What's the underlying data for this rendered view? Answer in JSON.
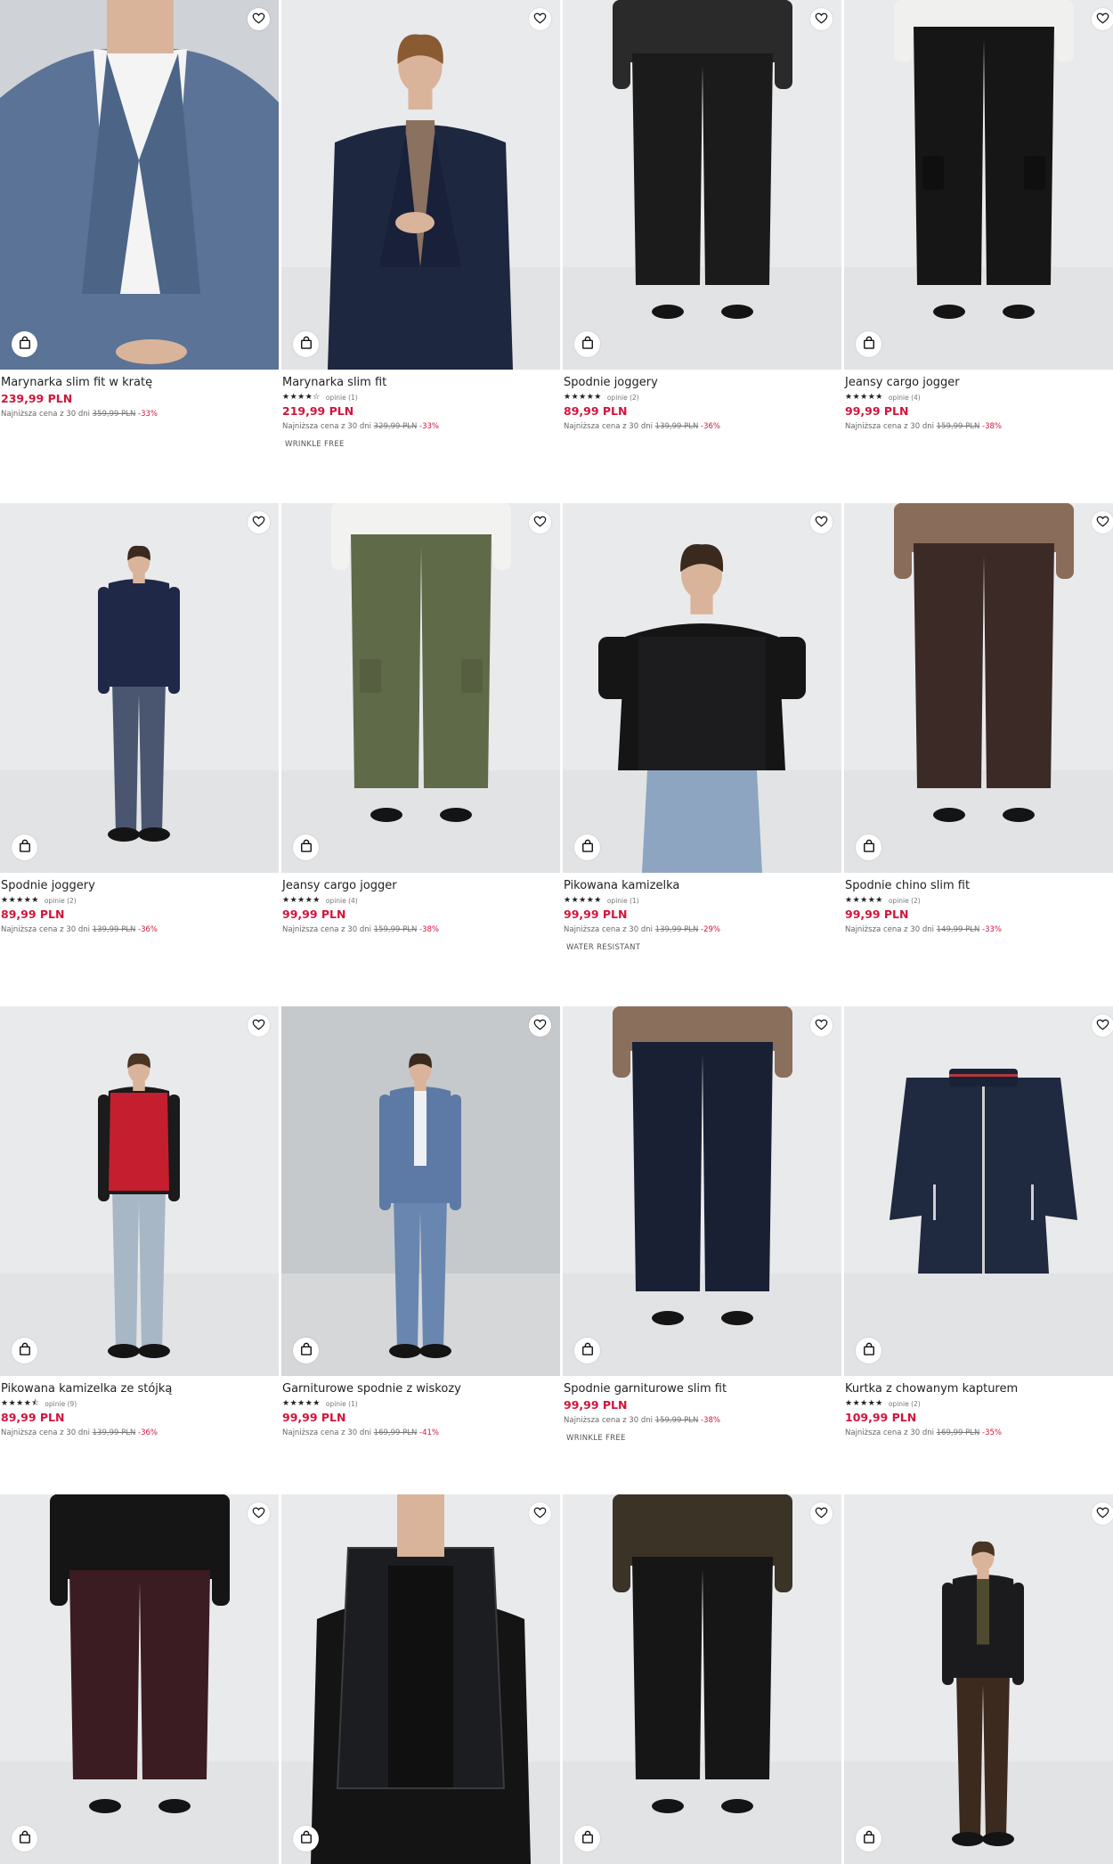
{
  "labels": {
    "lowest_prefix": "Najniższa cena z 30 dni"
  },
  "colors": {
    "price": "#d4143c",
    "text": "#222222",
    "background": "#ffffff"
  },
  "icons": {
    "favorite": "heart-icon",
    "cart": "shopping-bag-icon"
  },
  "products": [
    {
      "name": "Marynarka slim fit w kratę",
      "rating": null,
      "reviews": null,
      "price": "239,99 PLN",
      "old_price": "359,99 PLN",
      "discount": "-33%",
      "tag": null,
      "scene": "blazer-check"
    },
    {
      "name": "Marynarka slim fit",
      "rating": 4,
      "reviews": "opinie (1)",
      "price": "219,99 PLN",
      "old_price": "329,99 PLN",
      "discount": "-33%",
      "tag": "WRINKLE FREE",
      "scene": "blazer-navy"
    },
    {
      "name": "Spodnie joggery",
      "rating": 5,
      "reviews": "opinie (2)",
      "price": "89,99 PLN",
      "old_price": "139,99 PLN",
      "discount": "-36%",
      "tag": null,
      "scene": "pants-black"
    },
    {
      "name": "Jeansy cargo jogger",
      "rating": 5,
      "reviews": "opinie (4)",
      "price": "99,99 PLN",
      "old_price": "159,99 PLN",
      "discount": "-38%",
      "tag": null,
      "scene": "cargo-black"
    },
    {
      "name": "Spodnie joggery",
      "rating": 5,
      "reviews": "opinie (2)",
      "price": "89,99 PLN",
      "old_price": "139,99 PLN",
      "discount": "-36%",
      "tag": null,
      "scene": "full-navy"
    },
    {
      "name": "Jeansy cargo jogger",
      "rating": 5,
      "reviews": "opinie (4)",
      "price": "99,99 PLN",
      "old_price": "159,99 PLN",
      "discount": "-38%",
      "tag": null,
      "scene": "cargo-olive"
    },
    {
      "name": "Pikowana kamizelka",
      "rating": 5,
      "reviews": "opinie (1)",
      "price": "99,99 PLN",
      "old_price": "139,99 PLN",
      "discount": "-29%",
      "tag": "WATER RESISTANT",
      "scene": "vest-black"
    },
    {
      "name": "Spodnie chino slim fit",
      "rating": 5,
      "reviews": "opinie (2)",
      "price": "99,99 PLN",
      "old_price": "149,99 PLN",
      "discount": "-33%",
      "tag": null,
      "scene": "chino-brown"
    },
    {
      "name": "Pikowana kamizelka ze stójką",
      "rating": 4.5,
      "reviews": "opinie (9)",
      "price": "89,99 PLN",
      "old_price": "139,99 PLN",
      "discount": "-36%",
      "tag": null,
      "scene": "vest-red"
    },
    {
      "name": "Garniturowe spodnie z wiskozy",
      "rating": 5,
      "reviews": "opinie (1)",
      "price": "99,99 PLN",
      "old_price": "169,99 PLN",
      "discount": "-41%",
      "tag": null,
      "scene": "suit-blue"
    },
    {
      "name": "Spodnie garniturowe slim fit",
      "rating": null,
      "reviews": null,
      "price": "99,99 PLN",
      "old_price": "159,99 PLN",
      "discount": "-38%",
      "tag": "WRINKLE FREE",
      "scene": "pants-navy"
    },
    {
      "name": "Kurtka z chowanym kapturem",
      "rating": 5,
      "reviews": "opinie (2)",
      "price": "109,99 PLN",
      "old_price": "169,99 PLN",
      "discount": "-35%",
      "tag": null,
      "scene": "jacket-flat"
    },
    {
      "name": "",
      "rating": null,
      "reviews": null,
      "price": "",
      "old_price": "",
      "discount": "",
      "tag": null,
      "scene": "pants-burgundy"
    },
    {
      "name": "",
      "rating": null,
      "reviews": null,
      "price": "",
      "old_price": "",
      "discount": "",
      "tag": null,
      "scene": "vest-shiny"
    },
    {
      "name": "",
      "rating": null,
      "reviews": null,
      "price": "",
      "old_price": "",
      "discount": "",
      "tag": null,
      "scene": "pants-black2"
    },
    {
      "name": "",
      "rating": null,
      "reviews": null,
      "price": "",
      "old_price": "",
      "discount": "",
      "tag": null,
      "scene": "jacket-shirt"
    }
  ]
}
